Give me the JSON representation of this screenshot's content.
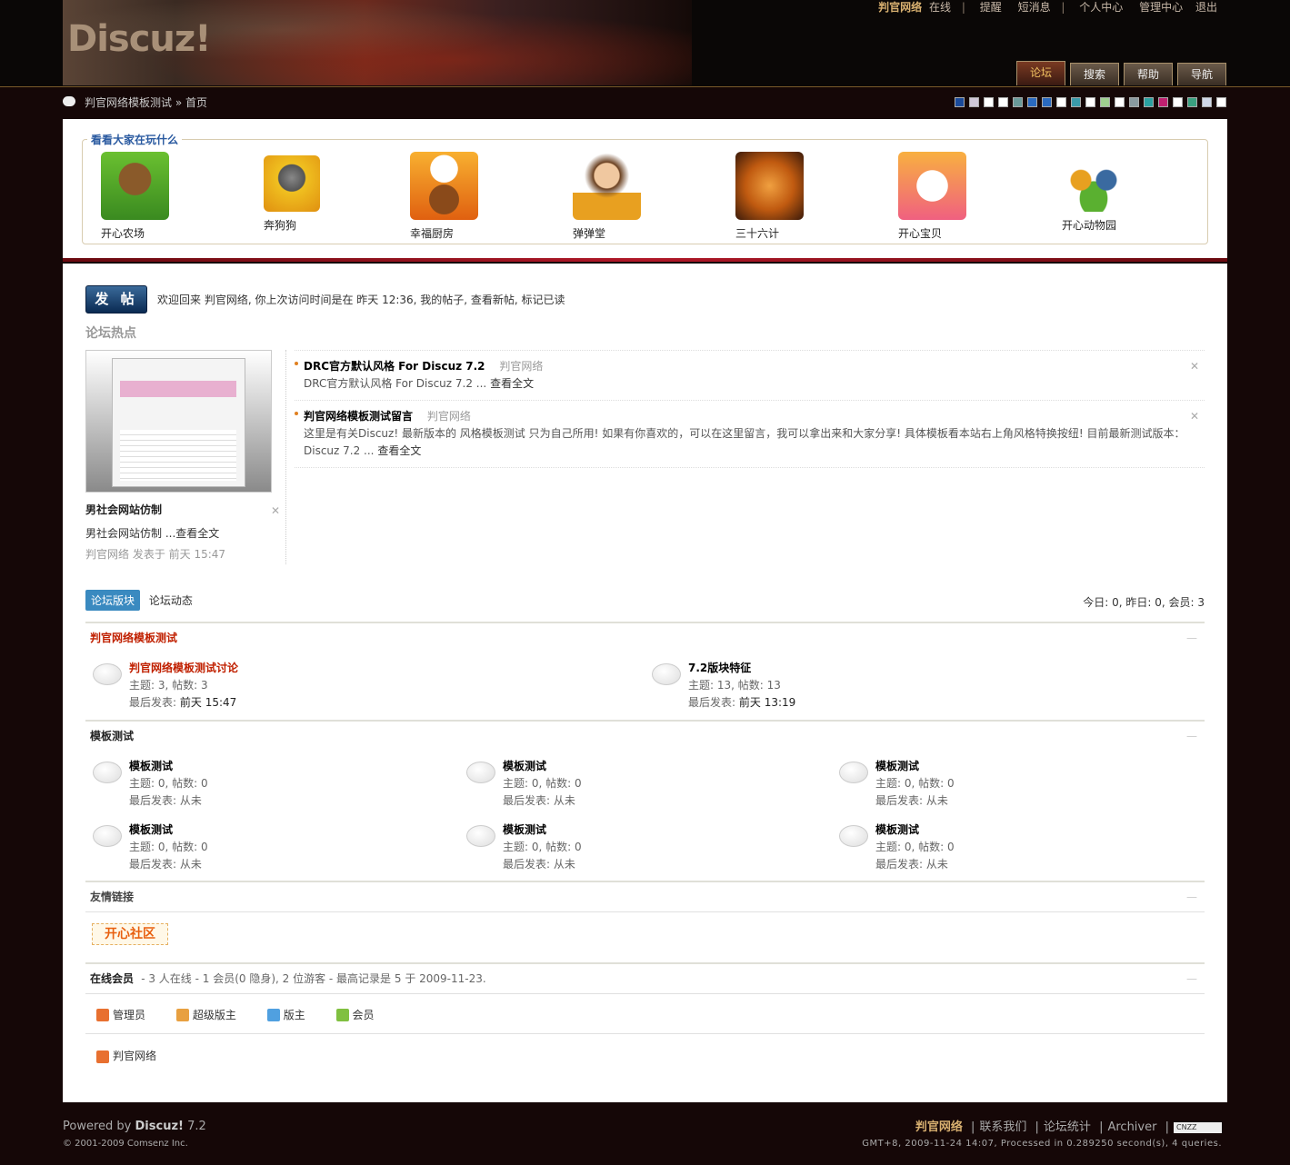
{
  "header": {
    "logo": "Discuz!",
    "user": "判官网络",
    "online_status": "在线",
    "links": [
      "提醒",
      "短消息",
      "个人中心",
      "管理中心",
      "退出"
    ],
    "tabs": [
      "论坛",
      "搜索",
      "帮助",
      "导航"
    ],
    "active_tab": "论坛"
  },
  "breadcrumb": {
    "site": "判官网络模板测试",
    "separator": "»",
    "current": "首页"
  },
  "style_swatches": [
    "#1a4a9a",
    "#d0c8d8",
    "#ffffff",
    "#ffffff",
    "#6a9a9a",
    "#2a6ac0",
    "#2a6ac0",
    "#ffffff",
    "#3a9aaa",
    "#ffffff",
    "#a0d090",
    "#ffffff",
    "#8a9aa0",
    "#2aa0a0",
    "#c02070",
    "#ffffff",
    "#3aa080",
    "#d0d8e8",
    "#ffffff"
  ],
  "games": {
    "title": "看看大家在玩什么",
    "items": [
      {
        "label": "开心农场"
      },
      {
        "label": "奔狗狗"
      },
      {
        "label": "幸福厨房"
      },
      {
        "label": "弹弹堂"
      },
      {
        "label": "三十六计"
      },
      {
        "label": "开心宝贝"
      },
      {
        "label": "开心动物园"
      }
    ]
  },
  "post_button": "发 帖",
  "welcome": "欢迎回来  判官网络, 你上次访问时间是在  昨天 12:36, 我的帖子, 查看新帖, 标记已读",
  "hot": {
    "title": "论坛热点",
    "featured": {
      "title": "男社会网站仿制",
      "desc": "男社会网站仿制 ...查看全文",
      "meta": "判官网络  发表于  前天 15:47"
    },
    "items": [
      {
        "title": "DRC官方默认风格  For Discuz 7.2",
        "author": "判官网络",
        "body": "DRC官方默认风格  For Discuz 7.2 ...",
        "more": "查看全文"
      },
      {
        "title": "判官网络模板测试留言",
        "author": "判官网络",
        "body": "这里是有关Discuz! 最新版本的  风格模板测试  只为自己所用!  如果有你喜欢的，可以在这里留言，我可以拿出来和大家分享!  具体模板看本站右上角风格特换按纽!  目前最新测试版本：Discuz 7.2 ...",
        "more": "查看全文"
      }
    ]
  },
  "forum_tabs": [
    "论坛版块",
    "论坛动态"
  ],
  "stats": "今日: 0, 昨日: 0, 会员: 3",
  "categories": [
    {
      "title": "判官网络模板测试",
      "forums": [
        {
          "name": "判官网络模板测试讨论",
          "stats": "主题: 3, 帖数: 3",
          "last_label": "最后发表:",
          "last_value": "前天 15:47"
        },
        {
          "name": "7.2版块特征",
          "stats": "主题: 13, 帖数: 13",
          "last_label": "最后发表:",
          "last_value": "前天 13:19"
        }
      ]
    },
    {
      "title": "模板测试",
      "forums": [
        {
          "name": "模板测试",
          "stats": "主题: 0, 帖数: 0",
          "last_label": "最后发表:",
          "last_value": "从未"
        },
        {
          "name": "模板测试",
          "stats": "主题: 0, 帖数: 0",
          "last_label": "最后发表:",
          "last_value": "从未"
        },
        {
          "name": "模板测试",
          "stats": "主题: 0, 帖数: 0",
          "last_label": "最后发表:",
          "last_value": "从未"
        },
        {
          "name": "模板测试",
          "stats": "主题: 0, 帖数: 0",
          "last_label": "最后发表:",
          "last_value": "从未"
        },
        {
          "name": "模板测试",
          "stats": "主题: 0, 帖数: 0",
          "last_label": "最后发表:",
          "last_value": "从未"
        },
        {
          "name": "模板测试",
          "stats": "主题: 0, 帖数: 0",
          "last_label": "最后发表:",
          "last_value": "从未"
        }
      ]
    }
  ],
  "collapse_symbol": "—",
  "friend_links": {
    "title": "友情链接",
    "logo_text": "开心社区"
  },
  "online": {
    "title": "在线会员",
    "summary": "- 3 人在线  - 1 会员(0 隐身), 2 位游客  - 最高记录是  5 于  2009-11-23.",
    "legend": [
      {
        "label": "管理员",
        "color": "#e87030"
      },
      {
        "label": "超级版主",
        "color": "#e8a040"
      },
      {
        "label": "版主",
        "color": "#50a0e0"
      },
      {
        "label": "会员",
        "color": "#80c040"
      }
    ],
    "users": [
      "判官网络"
    ]
  },
  "footer": {
    "powered_prefix": "Powered by",
    "powered_name": "Discuz!",
    "powered_version": "7.2",
    "copyright": "© 2001-2009 Comsenz Inc.",
    "site": "判官网络",
    "links": [
      "联系我们",
      "论坛统计",
      "Archiver"
    ],
    "cnzz": "CNZZ",
    "gmt": "GMT+8, 2009-11-24 14:07, Processed in 0.289250 second(s), 4 queries."
  },
  "colors": {
    "accent_blue": "#2a5aa0",
    "forum_red": "#c02000",
    "footer_gold": "#d8b070"
  }
}
